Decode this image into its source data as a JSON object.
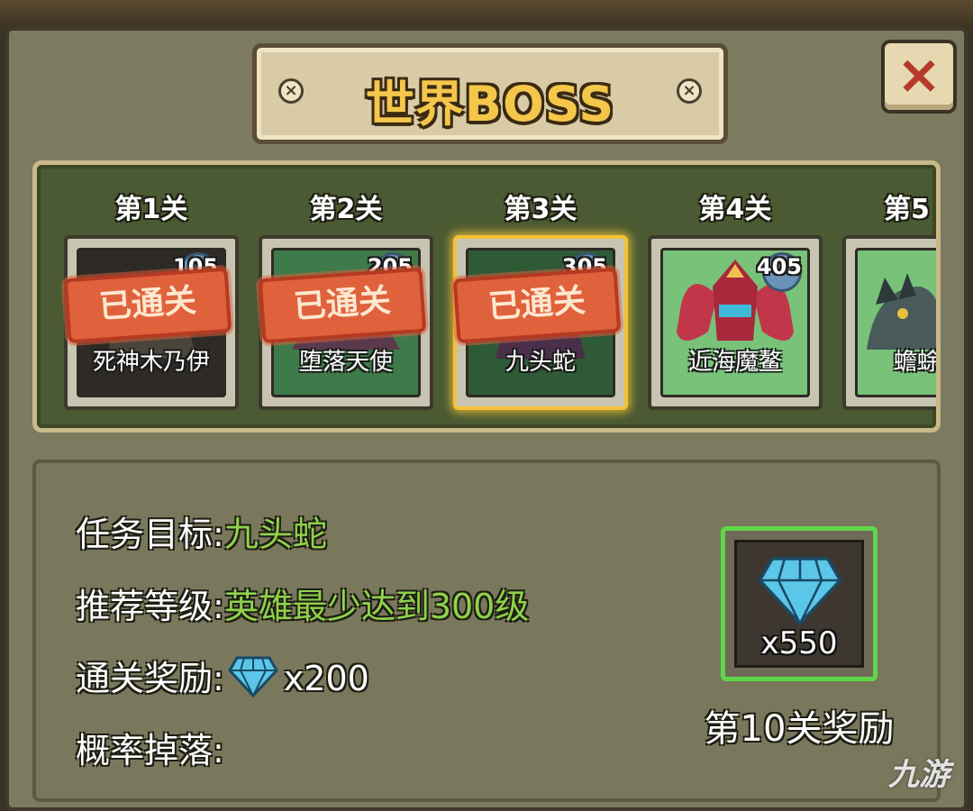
{
  "title": "世界BOSS",
  "close_label": "×",
  "stages": [
    {
      "label": "第1关",
      "level": "105",
      "name": "死神木乃伊",
      "cleared": true,
      "stamp": "已通关",
      "bg": "#2e2a26"
    },
    {
      "label": "第2关",
      "level": "205",
      "name": "堕落天使",
      "cleared": true,
      "stamp": "已通关",
      "bg": "#3f7a4a"
    },
    {
      "label": "第3关",
      "level": "305",
      "name": "九头蛇",
      "cleared": true,
      "stamp": "已通关",
      "bg": "#2f5a36",
      "selected": true
    },
    {
      "label": "第4关",
      "level": "405",
      "name": "近海魔鳌",
      "cleared": false,
      "bg": "#78c27a"
    },
    {
      "label": "第5",
      "level": "",
      "name": "蟾蜍",
      "cleared": false,
      "bg": "#78c27a"
    }
  ],
  "info": {
    "target_label": "任务目标:",
    "target_value": "九头蛇",
    "level_label": "推荐等级:",
    "level_value": "英雄最少达到300级",
    "reward_label": "通关奖励:",
    "reward_value": "x200",
    "drop_label": "概率掉落:"
  },
  "stage10_reward": {
    "count": "x550",
    "caption": "第10关奖励"
  },
  "watermark": "九游",
  "colors": {
    "title_gold": "#f4c64a",
    "value_green": "#8fd24a",
    "reward_border": "#5fd74a",
    "selected_border": "#f3c23a",
    "stamp_red": "#e0623c"
  }
}
